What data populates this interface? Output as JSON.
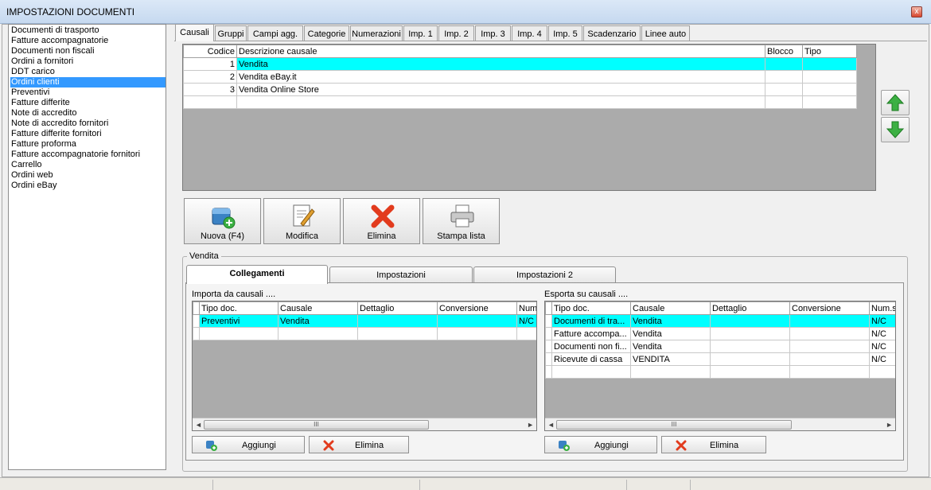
{
  "window": {
    "title": "IMPOSTAZIONI DOCUMENTI",
    "close": "x"
  },
  "doc_types": [
    "Documenti di trasporto",
    "Fatture accompagnatorie",
    "Documenti non fiscali",
    "Ordini a fornitori",
    "DDT carico",
    "Ordini clienti",
    "Preventivi",
    "Fatture differite",
    "Note di accredito",
    "Note di accredito fornitori",
    "Fatture differite fornitori",
    "Fatture proforma",
    "Fatture accompagnatorie fornitori",
    "Carrello",
    "Ordini web",
    "Ordini eBay"
  ],
  "selected_doc_type": "Ordini clienti",
  "tabs": [
    "Causali",
    "Gruppi",
    "Campi agg.",
    "Categorie",
    "Numerazioni",
    "Imp. 1",
    "Imp. 2",
    "Imp. 3",
    "Imp. 4",
    "Imp. 5",
    "Scadenzario",
    "Linee auto"
  ],
  "active_tab": "Causali",
  "causali_table": {
    "columns": [
      "Codice",
      "Descrizione causale",
      "Blocco",
      "Tipo"
    ],
    "rows": [
      {
        "codice": "1",
        "descrizione": "Vendita",
        "blocco": "",
        "tipo": ""
      },
      {
        "codice": "2",
        "descrizione": "Vendita eBay.it",
        "blocco": "",
        "tipo": ""
      },
      {
        "codice": "3",
        "descrizione": "Vendita Online Store",
        "blocco": "",
        "tipo": ""
      }
    ],
    "selected_row": 0
  },
  "actions": {
    "new": "Nuova (F4)",
    "edit": "Modifica",
    "delete": "Elimina",
    "print": "Stampa lista"
  },
  "group": {
    "label": "Vendita"
  },
  "subtabs": [
    "Collegamenti",
    "Impostazioni",
    "Impostazioni 2"
  ],
  "active_subtab": "Collegamenti",
  "import_panel": {
    "label": "Importa da causali ....",
    "columns": [
      "Tipo doc.",
      "Causale",
      "Dettaglio",
      "Conversione",
      "Num"
    ],
    "rows": [
      [
        "Preventivi",
        "Vendita",
        "",
        "",
        "N/C"
      ]
    ],
    "add": "Aggiungi",
    "delete": "Elimina"
  },
  "export_panel": {
    "label": "Esporta su causali ....",
    "columns": [
      "Tipo doc.",
      "Causale",
      "Dettaglio",
      "Conversione",
      "Num.s"
    ],
    "rows": [
      [
        "Documenti di tra...",
        "Vendita",
        "",
        "",
        "N/C"
      ],
      [
        "Fatture accompa...",
        "Vendita",
        "",
        "",
        "N/C"
      ],
      [
        "Documenti non fi...",
        "Vendita",
        "",
        "",
        "N/C"
      ],
      [
        "Ricevute di cassa",
        "VENDITA",
        "",
        "",
        "N/C"
      ]
    ],
    "add": "Aggiungi",
    "delete": "Elimina"
  },
  "scroll_thumb": "III",
  "colors": {
    "highlight": "#00ffff",
    "selection": "#3399ff",
    "grid_bg": "#ababab",
    "arrow_green": "#3cb043"
  }
}
